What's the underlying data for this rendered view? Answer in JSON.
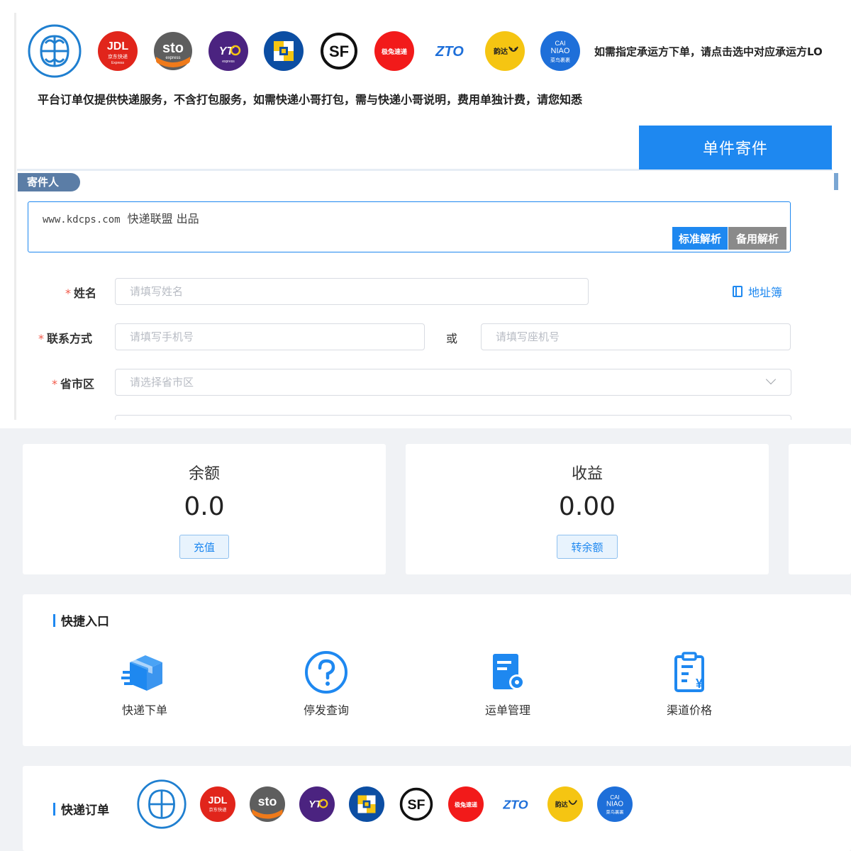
{
  "carriers": {
    "main_logo": "cainiao-courier-logo",
    "items": [
      {
        "name": "jdl-logo",
        "text": "JDL",
        "sub": "京东快递",
        "color": "#e1251b"
      },
      {
        "name": "sto-logo",
        "text": "sto",
        "sub": "express",
        "color": "#5a5a5a"
      },
      {
        "name": "yto-logo",
        "text": "YTO",
        "sub": "express",
        "color": "#4b2380"
      },
      {
        "name": "yunda-logo",
        "text": "",
        "sub": "",
        "color": "#0c4ea3"
      },
      {
        "name": "sf-logo",
        "text": "SF",
        "sub": "",
        "color": "#111111"
      },
      {
        "name": "jitu-logo",
        "text": "极兔速递",
        "sub": "",
        "color": "#f21a1a"
      },
      {
        "name": "zto-logo",
        "text": "ZTO",
        "sub": "",
        "color": "#1e6fd9"
      },
      {
        "name": "yunda-express-logo",
        "text": "韵达",
        "sub": "",
        "color": "#f5c512"
      },
      {
        "name": "cainiao-logo",
        "text": "CAI NIAO",
        "sub": "菜鸟裹裹",
        "color": "#1e6fd9"
      }
    ],
    "note": "如需指定承运方下单，请点击选中对应承运方LO"
  },
  "notice": "平台订单仅提供快递服务，不含打包服务，如需快递小哥打包，需与快递小哥说明，费用单独计费，请您知悉",
  "tabs": {
    "single": "单件寄件"
  },
  "sender": {
    "tag": "寄件人",
    "parse_site": "www.kdcps.com",
    "parse_text": "快递联盟 出品",
    "btn_standard": "标准解析",
    "btn_backup": "备用解析",
    "name_label": "姓名",
    "name_placeholder": "请填写姓名",
    "address_book": "地址簿",
    "contact_label": "联系方式",
    "mobile_placeholder": "请填写手机号",
    "or": "或",
    "phone_placeholder": "请填写座机号",
    "region_label": "省市区",
    "region_placeholder": "请选择省市区"
  },
  "stats": {
    "balance_title": "余额",
    "balance_value": "0.0",
    "balance_btn": "充值",
    "income_title": "收益",
    "income_value": "0.00",
    "income_btn": "转余额"
  },
  "quick": {
    "title": "快捷入口",
    "items": [
      {
        "label": "快递下单",
        "icon": "package-icon"
      },
      {
        "label": "停发查询",
        "icon": "question-icon"
      },
      {
        "label": "运单管理",
        "icon": "waybill-settings-icon"
      },
      {
        "label": "渠道价格",
        "icon": "price-list-icon"
      }
    ]
  },
  "orders": {
    "title": "快递订单"
  },
  "colors": {
    "primary": "#1e88f0",
    "required": "#f25a4a",
    "tag": "#5b7da6"
  }
}
